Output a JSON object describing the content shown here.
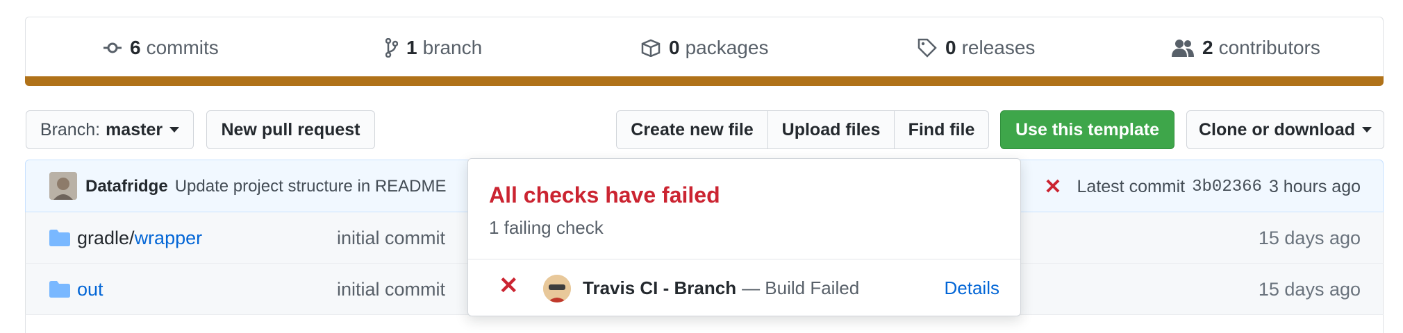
{
  "summary": {
    "commits": {
      "count": "6",
      "label": "commits",
      "icon": "commit-icon"
    },
    "branches": {
      "count": "1",
      "label": "branch",
      "icon": "branch-icon"
    },
    "packages": {
      "count": "0",
      "label": "packages",
      "icon": "package-icon"
    },
    "releases": {
      "count": "0",
      "label": "releases",
      "icon": "tag-icon"
    },
    "contributors": {
      "count": "2",
      "label": "contributors",
      "icon": "people-icon"
    },
    "language_bar_color": "#b07219"
  },
  "toolbar": {
    "branch_prefix": "Branch:",
    "branch_name": "master",
    "new_pull_request": "New pull request",
    "create_new_file": "Create new file",
    "upload_files": "Upload files",
    "find_file": "Find file",
    "use_template": "Use this template",
    "clone_download": "Clone or download"
  },
  "commit": {
    "author": "Datafridge",
    "message": "Update project structure in README",
    "status_icon": "x-icon",
    "latest_label": "Latest commit",
    "sha": "3b02366",
    "age": "3 hours ago"
  },
  "files": [
    {
      "name_prefix": "gradle/",
      "name_link": "wrapper",
      "message": "initial commit",
      "age": "15 days ago"
    },
    {
      "name_prefix": "",
      "name_link": "out",
      "message": "initial commit",
      "age": "15 days ago"
    }
  ],
  "popover": {
    "title": "All checks have failed",
    "subtitle": "1 failing check",
    "check_name": "Travis CI - Branch",
    "check_status": "— Build Failed",
    "details": "Details"
  },
  "colors": {
    "accent_link": "#0366d6",
    "fail_red": "#cb2431",
    "template_green": "#3ea64a"
  }
}
